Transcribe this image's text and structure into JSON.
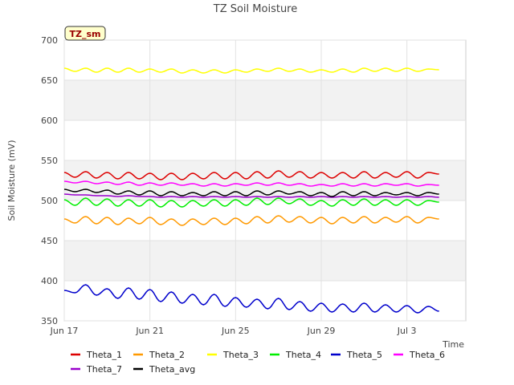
{
  "chart_data": {
    "type": "line",
    "title": "TZ Soil Moisture",
    "xlabel": "Time",
    "ylabel": "Soil Moisture (mV)",
    "badge": "TZ_sm",
    "ylim": [
      350,
      700
    ],
    "xlim": [
      0,
      18.75
    ],
    "yticks": [
      350,
      400,
      450,
      500,
      550,
      600,
      650,
      700
    ],
    "xticks": [
      {
        "value": 0,
        "label": "Jun 17"
      },
      {
        "value": 4,
        "label": "Jun 21"
      },
      {
        "value": 8,
        "label": "Jun 25"
      },
      {
        "value": 12,
        "label": "Jun 29"
      },
      {
        "value": 16,
        "label": "Jul 3"
      }
    ],
    "grid": true,
    "legend_position": "bottom",
    "x_day_offsets": [
      0,
      0.5,
      1,
      1.5,
      2,
      2.5,
      3,
      3.5,
      4,
      4.5,
      5,
      5.5,
      6,
      6.5,
      7,
      7.5,
      8,
      8.5,
      9,
      9.5,
      10,
      10.5,
      11,
      11.5,
      12,
      12.5,
      13,
      13.5,
      14,
      14.5,
      15,
      15.5,
      16,
      16.5,
      17,
      17.5
    ],
    "series": [
      {
        "name": "Theta_1",
        "color": "#dd0000",
        "values": [
          535,
          529,
          536,
          528,
          535,
          527,
          535,
          527,
          534,
          526,
          534,
          526,
          534,
          527,
          535,
          527,
          535,
          527,
          536,
          528,
          537,
          529,
          536,
          528,
          535,
          528,
          535,
          528,
          536,
          528,
          535,
          529,
          536,
          528,
          535,
          533
        ]
      },
      {
        "name": "Theta_2",
        "color": "#ff9900",
        "values": [
          477,
          472,
          480,
          471,
          479,
          470,
          478,
          471,
          479,
          470,
          477,
          469,
          477,
          470,
          478,
          470,
          478,
          471,
          480,
          472,
          481,
          473,
          480,
          472,
          479,
          471,
          479,
          472,
          480,
          472,
          479,
          473,
          480,
          472,
          479,
          477
        ]
      },
      {
        "name": "Theta_3",
        "color": "#ffff00",
        "values": [
          665,
          661,
          665,
          660,
          665,
          660,
          665,
          660,
          664,
          660,
          664,
          659,
          663,
          659,
          663,
          659,
          663,
          660,
          664,
          661,
          665,
          661,
          664,
          660,
          663,
          660,
          664,
          660,
          665,
          661,
          665,
          661,
          665,
          661,
          664,
          663
        ]
      },
      {
        "name": "Theta_4",
        "color": "#00ee00",
        "values": [
          501,
          494,
          503,
          494,
          502,
          493,
          501,
          493,
          501,
          492,
          500,
          492,
          500,
          493,
          501,
          493,
          501,
          494,
          503,
          495,
          503,
          496,
          502,
          494,
          500,
          493,
          501,
          494,
          502,
          494,
          501,
          494,
          501,
          494,
          500,
          498
        ]
      },
      {
        "name": "Theta_5",
        "color": "#0000cc",
        "values": [
          388,
          385,
          395,
          382,
          390,
          378,
          391,
          377,
          389,
          374,
          386,
          372,
          383,
          370,
          383,
          368,
          379,
          367,
          377,
          365,
          378,
          364,
          374,
          362,
          372,
          361,
          371,
          361,
          372,
          361,
          370,
          361,
          369,
          360,
          368,
          362
        ]
      },
      {
        "name": "Theta_6",
        "color": "#ff00ff",
        "values": [
          524,
          522,
          524,
          521,
          523,
          520,
          523,
          519,
          522,
          519,
          522,
          519,
          521,
          518,
          521,
          518,
          521,
          519,
          522,
          519,
          522,
          519,
          521,
          518,
          520,
          518,
          521,
          518,
          521,
          518,
          521,
          519,
          521,
          518,
          520,
          519
        ]
      },
      {
        "name": "Theta_7",
        "color": "#9900cc",
        "values": [
          508,
          507,
          507,
          506,
          506,
          505,
          506,
          505,
          505,
          504,
          505,
          504,
          505,
          504,
          505,
          504,
          505,
          504,
          505,
          504,
          505,
          504,
          505,
          504,
          505,
          504,
          505,
          504,
          505,
          504,
          505,
          504,
          505,
          504,
          505,
          504
        ]
      },
      {
        "name": "Theta_avg",
        "color": "#000000",
        "values": [
          514,
          511,
          514,
          510,
          513,
          508,
          512,
          507,
          512,
          506,
          511,
          506,
          510,
          506,
          511,
          506,
          511,
          506,
          512,
          507,
          512,
          508,
          511,
          506,
          510,
          505,
          511,
          506,
          511,
          506,
          510,
          507,
          510,
          506,
          510,
          508
        ]
      }
    ]
  }
}
